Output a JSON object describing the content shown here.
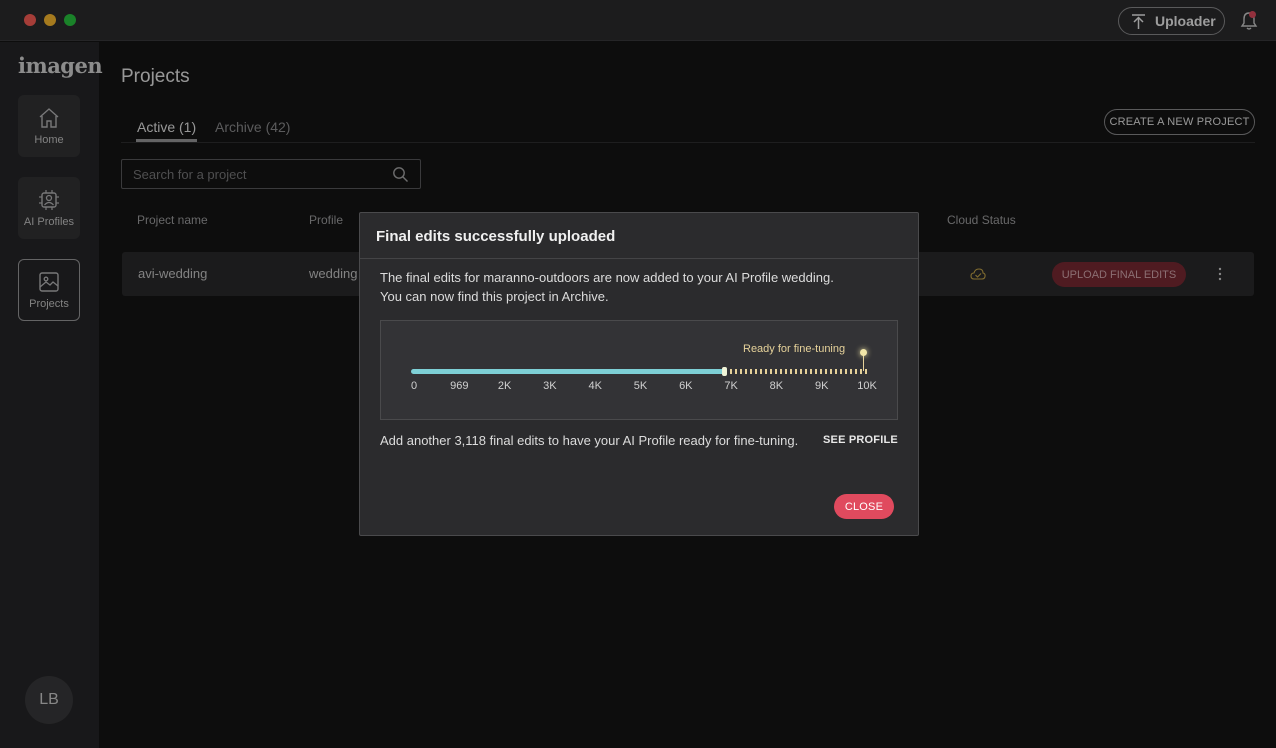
{
  "window": {
    "uploader_label": "Uploader",
    "notification_badge_color": "#e24b5e"
  },
  "sidebar": {
    "logo": "imagen",
    "items": [
      {
        "label": "Home",
        "icon": "home-icon"
      },
      {
        "label": "AI Profiles",
        "icon": "ai-chip-icon"
      },
      {
        "label": "Projects",
        "icon": "image-icon"
      }
    ],
    "active": "Projects",
    "avatar_initials": "LB"
  },
  "main": {
    "title": "Projects",
    "tabs": [
      {
        "label": "Active (1)",
        "selected": true
      },
      {
        "label": "Archive (42)",
        "selected": false
      }
    ],
    "create_button": "CREATE A NEW PROJECT",
    "search": {
      "placeholder": "Search for a project",
      "value": ""
    },
    "table": {
      "columns": [
        "Project name",
        "Profile",
        "Cloud Status"
      ],
      "rows": [
        {
          "project_name": "avi-wedding",
          "profile": "wedding",
          "cloud_status_icon": "cloud-check-icon",
          "action": "UPLOAD FINAL EDITS"
        }
      ]
    }
  },
  "modal": {
    "title": "Final edits successfully uploaded",
    "line1": "The final edits for maranno-outdoors are now added to your AI Profile wedding.",
    "line2": "You can now find this project in Archive.",
    "progress": {
      "ready_label": "Ready for fine-tuning",
      "current": 6882,
      "target": 10000,
      "axis_max": 10000,
      "ticks": [
        "0",
        "969",
        "2K",
        "3K",
        "4K",
        "5K",
        "6K",
        "7K",
        "8K",
        "9K",
        "10K"
      ],
      "tick_values": [
        0,
        969,
        2000,
        3000,
        4000,
        5000,
        6000,
        7000,
        8000,
        9000,
        10000
      ],
      "fill_color": "#7ed0d6",
      "remaining_color": "#e6d29a"
    },
    "footer_text": "Add another 3,118 final edits to have your AI Profile ready for fine-tuning.",
    "see_profile": "SEE PROFILE",
    "close": "CLOSE",
    "accent": "#e04a5e"
  }
}
